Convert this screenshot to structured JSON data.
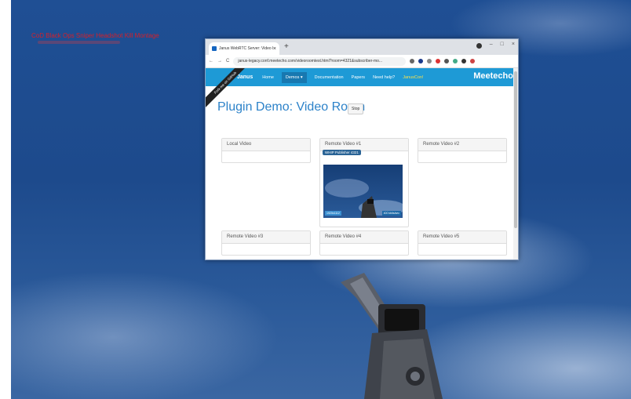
{
  "hud": {
    "text": "CoD Black Ops Sniper Headshot Kill Montage"
  },
  "browser": {
    "tab_title": "Janus WebRTC Server: Video Ro...",
    "tab_close": "×",
    "new_tab": "+",
    "url": "janus-legacy.conf.meetecho.com/videoroomtest.html?room=4321&subscriber-mo...",
    "nav_back": "←",
    "nav_forward": "→",
    "reload": "C",
    "win_min": "–",
    "win_max": "□",
    "win_close": "×"
  },
  "navbar": {
    "brand": "Janus",
    "items": [
      "Home",
      "Demos ▾",
      "Documentation",
      "Papers",
      "Need help?",
      "JanusCon!"
    ],
    "logo": "Meetecho",
    "ribbon": "Fork me on GitHub"
  },
  "page": {
    "title": "Plugin Demo: Video Room",
    "stop_label": "Stop",
    "panels": [
      "Local Video",
      "Remote Video #1",
      "Remote Video #2",
      "Remote Video #3",
      "Remote Video #4",
      "Remote Video #5"
    ],
    "publisher_badge": "WHIP Publisher 4321",
    "video_resolution": "1920x1112",
    "video_bitrate": "400 kbits/sec"
  },
  "colors": {
    "navbar": "#1e9ad6",
    "title": "#2c82c9",
    "hud_text": "#d4202a"
  }
}
